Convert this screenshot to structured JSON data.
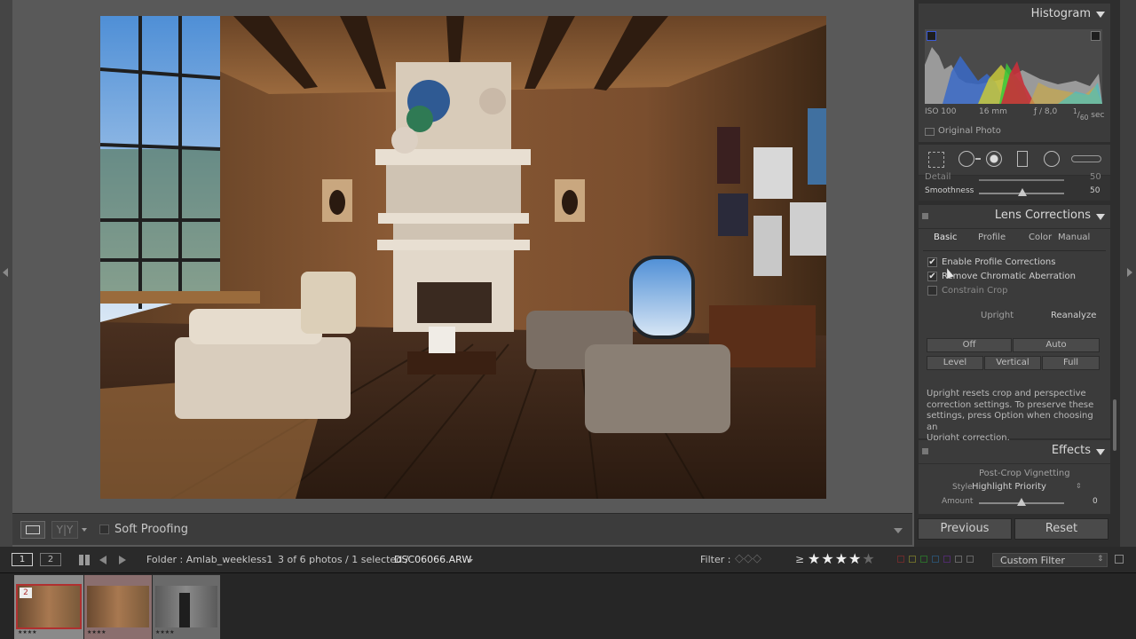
{
  "toolbar": {
    "soft_proofing_label": "Soft Proofing"
  },
  "histogram": {
    "title": "Histogram",
    "iso": "ISO 100",
    "focal": "16 mm",
    "aperture": "ƒ / 8,0",
    "shutter_num": "1",
    "shutter_den": "60",
    "shutter_unit": "sec",
    "original_photo_label": "Original Photo"
  },
  "detail": {
    "detail_label": "Detail",
    "detail_value": "50",
    "smoothness_label": "Smoothness",
    "smoothness_value": "50"
  },
  "lens_corrections": {
    "title": "Lens Corrections",
    "tabs": [
      "Basic",
      "Profile",
      "Color",
      "Manual"
    ],
    "enable_profile_label": "Enable Profile Corrections",
    "remove_ca_label": "Remove Chromatic Aberration",
    "constrain_crop_label": "Constrain Crop",
    "upright_label": "Upright",
    "reanalyze_label": "Reanalyze",
    "upright_buttons_row1": [
      "Off",
      "Auto"
    ],
    "upright_buttons_row2": [
      "Level",
      "Vertical",
      "Full"
    ],
    "help_text_lines": [
      "Upright resets crop and perspective",
      "correction settings. To preserve these",
      "settings, press Option when choosing an",
      "Upright correction."
    ]
  },
  "effects": {
    "title": "Effects",
    "post_crop_label": "Post-Crop Vignetting",
    "style_label": "Style",
    "style_value": "Highlight Priority",
    "amount_label": "Amount",
    "amount_value": "0"
  },
  "buttons": {
    "previous": "Previous",
    "reset": "Reset"
  },
  "filmstrip": {
    "view1": "1",
    "view2": "2",
    "folder": "Folder : Amlab_weekless1",
    "count": "3 of 6 photos / 1 selected /",
    "filename": "DSC06066.ARW",
    "filter_label": "Filter :",
    "rating_op": "≥",
    "custom_filter": "Custom Filter",
    "thumb1_badge": "2"
  },
  "colors": {
    "accent_label_colors": [
      "#6b2b2b",
      "#6b6b2b",
      "#2b6b2b",
      "#2b4f6b",
      "#4f2b6b"
    ]
  }
}
